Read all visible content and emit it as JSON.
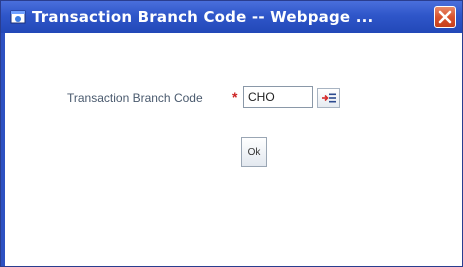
{
  "window": {
    "title": "Transaction Branch Code -- Webpage ...",
    "close_icon": "close-icon",
    "app_icon": "ie-window-icon"
  },
  "form": {
    "field_label": "Transaction Branch Code",
    "required_marker": "*",
    "branch_code_value": "CHO",
    "lov_icon": "list-of-values-icon",
    "ok_label": "Ok"
  },
  "colors": {
    "titlebar": "#2f56c9",
    "close_button": "#d9532e",
    "label_text": "#4a5a6e",
    "required_marker": "#cc2222"
  }
}
